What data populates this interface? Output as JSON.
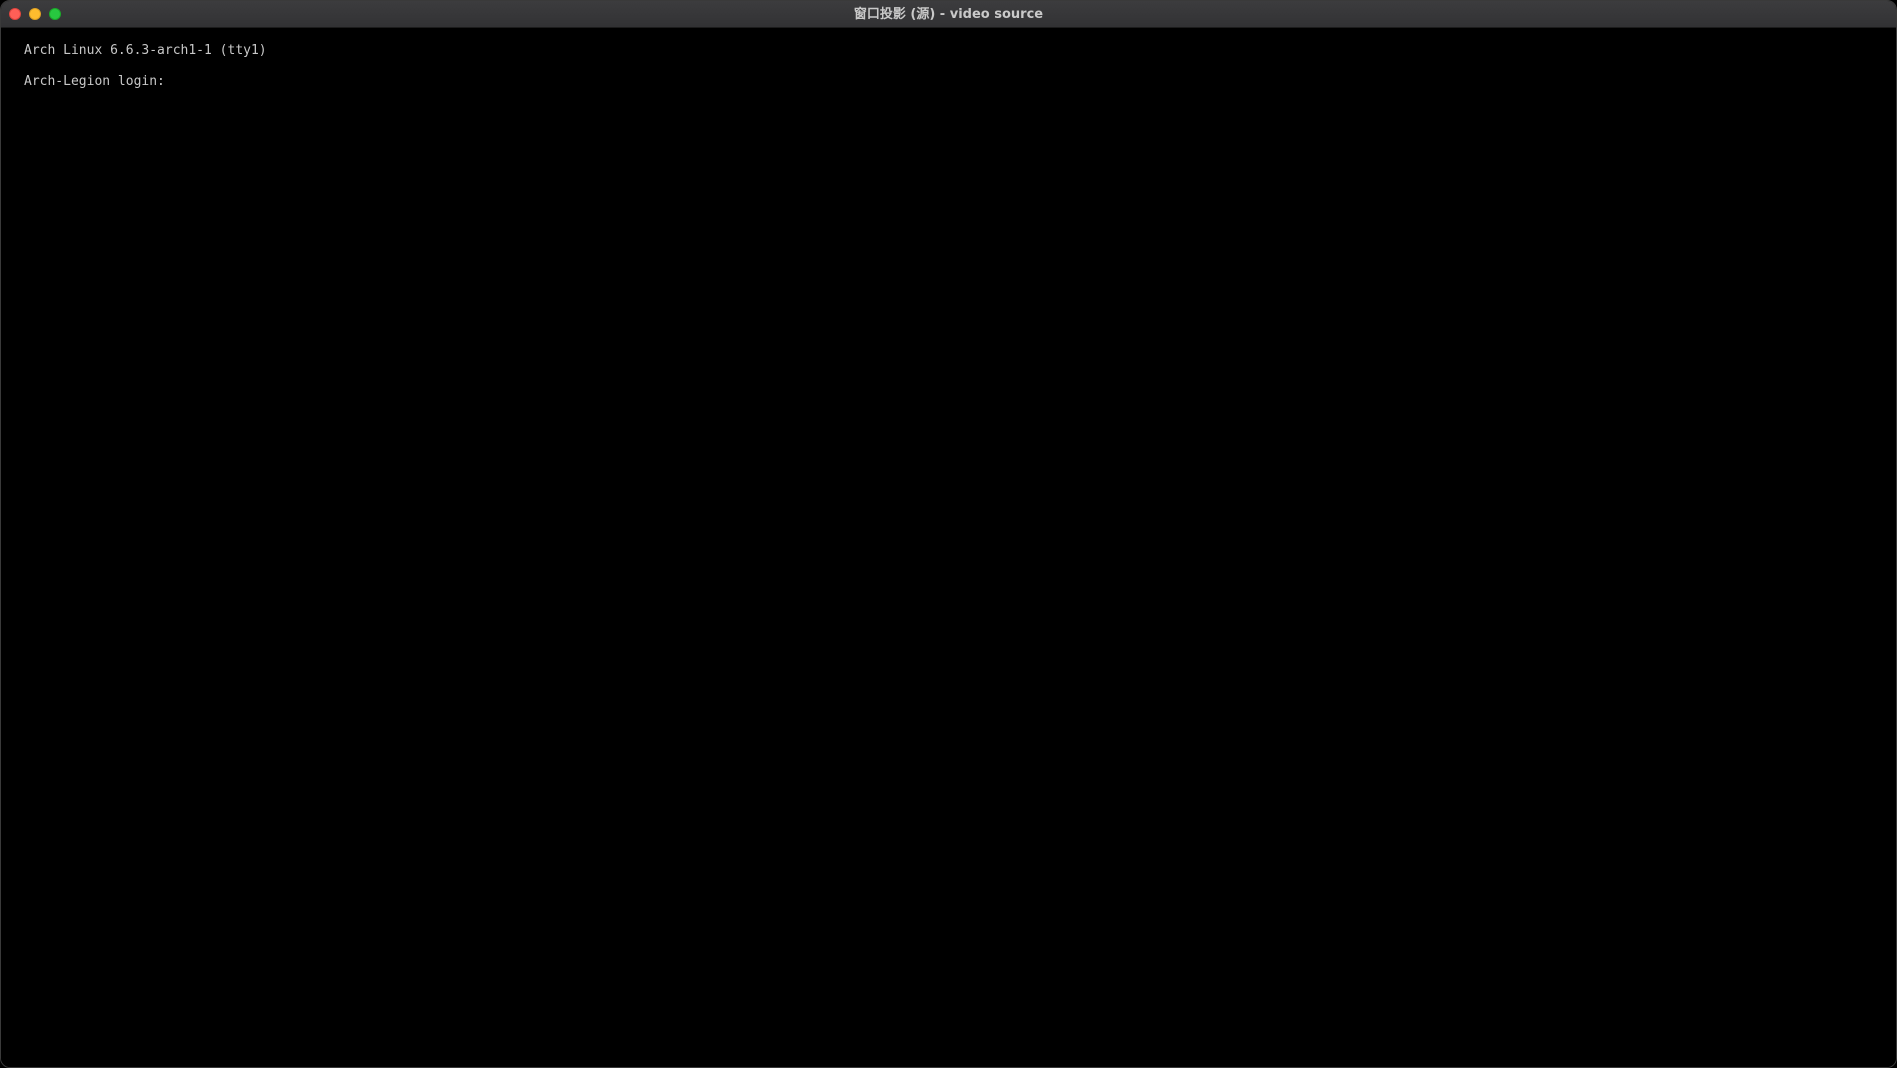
{
  "window": {
    "title": "窗口投影 (源) - video source",
    "traffic_lights": {
      "close": {
        "icon": "close-icon",
        "color": "#ff5f57",
        "border": "#e0443e"
      },
      "minimize": {
        "icon": "minimize-icon",
        "color": "#febc2e",
        "border": "#dea123"
      },
      "zoom": {
        "icon": "zoom-icon",
        "color": "#28c840",
        "border": "#1aab29"
      }
    }
  },
  "terminal": {
    "banner": "Arch Linux 6.6.3-arch1-1 (tty1)",
    "login_prompt": "Arch-Legion login:",
    "login_value": "",
    "colors": {
      "background": "#000000",
      "foreground": "#c8c8c8"
    }
  }
}
